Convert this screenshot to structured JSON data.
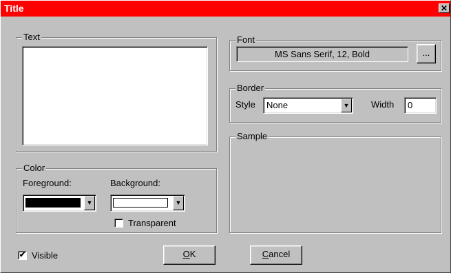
{
  "window": {
    "title": "Title",
    "close_glyph": "✕"
  },
  "text_group": {
    "label": "Text",
    "value": ""
  },
  "font_group": {
    "label": "Font",
    "current_font": "MS Sans Serif, 12, Bold",
    "browse_label": "..."
  },
  "border_group": {
    "label": "Border",
    "style_label": "Style",
    "style_value": "None",
    "width_label": "Width",
    "width_value": "0"
  },
  "sample_group": {
    "label": "Sample"
  },
  "color_group": {
    "label": "Color",
    "foreground_label": "Foreground:",
    "background_label": "Background:",
    "foreground_color": "#000000",
    "background_color": "#ffffff",
    "transparent_label": "Transparent",
    "transparent_checked": false
  },
  "visible": {
    "label": "Visible",
    "checked": true,
    "check_glyph": "✔"
  },
  "buttons": {
    "ok_label": "OK",
    "ok_underline": "O",
    "ok_rest": "K",
    "cancel_underline": "C",
    "cancel_rest": "ancel"
  },
  "icons": {
    "dropdown_arrow": "▼"
  }
}
